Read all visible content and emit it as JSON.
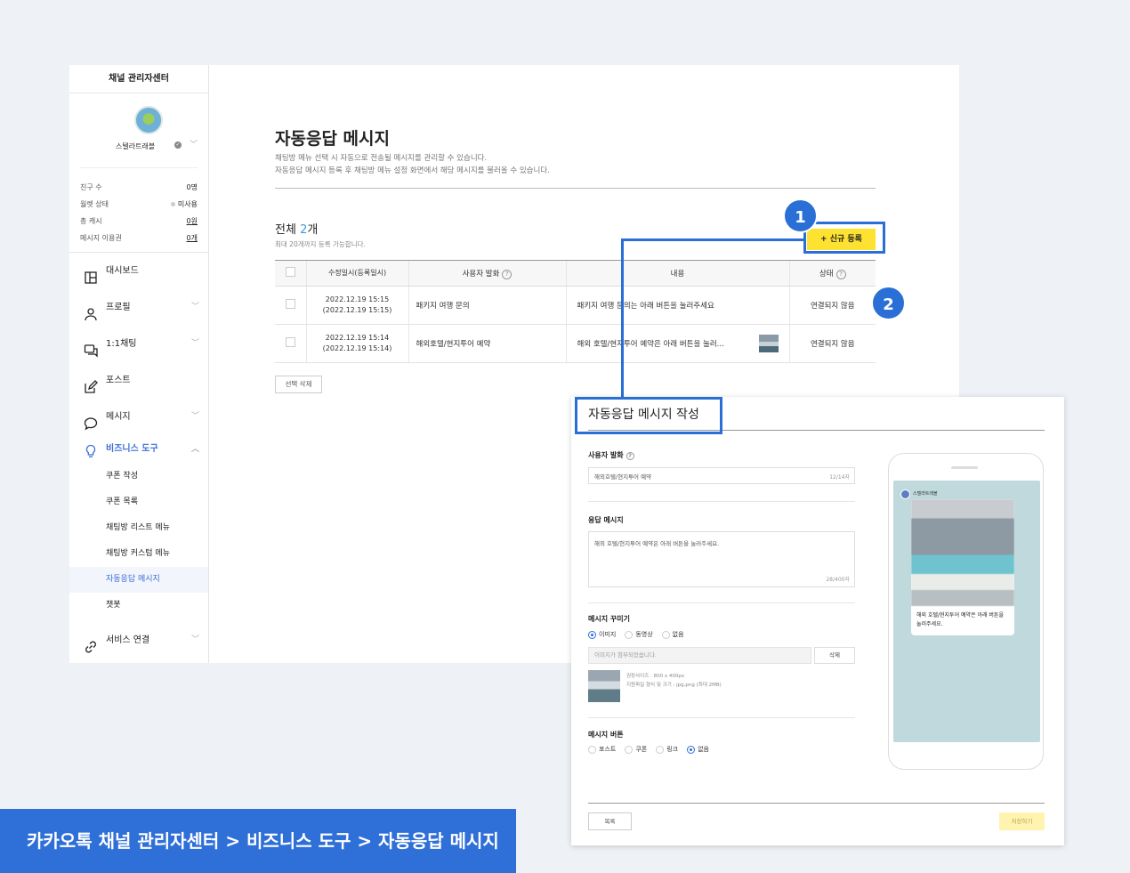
{
  "sidebar": {
    "title": "채널 관리자센터",
    "channel_name": "스텔라트래블",
    "stats": [
      {
        "label": "친구 수",
        "value": "0명"
      },
      {
        "label": "월렛 상태",
        "value": "미사용"
      },
      {
        "label": "총 캐시",
        "value": "0원"
      },
      {
        "label": "메시지 이용권",
        "value": "0개"
      }
    ],
    "nav": [
      {
        "label": "대시보드",
        "icon": "dashboard-icon"
      },
      {
        "label": "프로필",
        "icon": "person-icon"
      },
      {
        "label": "1:1채팅",
        "icon": "chat-icon"
      },
      {
        "label": "포스트",
        "icon": "edit-icon"
      },
      {
        "label": "메시지",
        "icon": "message-icon"
      },
      {
        "label": "비즈니스 도구",
        "icon": "lightbulb-icon"
      },
      {
        "label": "서비스 연결",
        "icon": "link-icon"
      }
    ],
    "business_sub": [
      "쿠폰 작성",
      "쿠폰 목록",
      "채팅방 리스트 메뉴",
      "채팅방 커스텀 메뉴",
      "자동응답 메시지",
      "챗봇"
    ]
  },
  "main": {
    "title": "자동응답 메시지",
    "desc1": "채팅방 메뉴 선택 시 자동으로 전송될 메시지를 관리할 수 있습니다.",
    "desc2": "자동응답 메시지 등록 후 채팅방 메뉴 설정 화면에서 해당 메시지를 불러올 수 있습니다.",
    "total_label": "전체 ",
    "total_count": "2",
    "total_unit": "개",
    "limit_note": "최대 20개까지 등록 가능합니다.",
    "new_button": "+ 신규 등록",
    "delete_button": "선택 삭제",
    "columns": [
      "수정일시(등록일시)",
      "사용자 발화",
      "내용",
      "상태"
    ],
    "rows": [
      {
        "date": "2022.12.19 15:15",
        "date_reg": "(2022.12.19 15:15)",
        "utterance": "패키지 여행 문의",
        "content": "패키지 여행 문의는 아래 버튼을 눌러주세요",
        "status": "연결되지 않음"
      },
      {
        "date": "2022.12.19 15:14",
        "date_reg": "(2022.12.19 15:14)",
        "utterance": "해외호텔/현지투어 예약",
        "content": "해외 호텔/현지투어 예약은 아래 버튼을 눌러...",
        "status": "연결되지 않음"
      }
    ]
  },
  "markers": [
    "1",
    "2"
  ],
  "editor": {
    "title": "자동응답 메시지 작성",
    "utterance_label": "사용자 발화",
    "utterance_value": "해외호텔/현지투어 예약",
    "utterance_count": "12/14자",
    "response_label": "응답 메시지",
    "response_value": "해외 호텔/현지투어 예약은 아래 버튼을 눌러주세요.",
    "response_count": "28/400자",
    "decorate_label": "메시지 꾸미기",
    "decorate_options": [
      "이미지",
      "동영상",
      "없음"
    ],
    "file_placeholder": "이미지가 첨부되었습니다.",
    "file_delete": "삭제",
    "img_info1": "권장사이즈 : 800 x 400px",
    "img_info2": "지원파일 형식 및 크기 : jpg,png (최대 2MB)",
    "button_label": "메시지 버튼",
    "button_options": [
      "포스트",
      "쿠폰",
      "링크",
      "없음"
    ],
    "list_button": "목록",
    "save_button": "저장하기"
  },
  "preview": {
    "channel_name": "스텔라트래블",
    "message": "해외 호텔/현지투어 예약은 아래 버튼을 눌러주세요."
  },
  "caption": "카카오톡 채널 관리자센터 > 비즈니스 도구 > 자동응답 메시지",
  "colors": {
    "accent": "#2a6fd6",
    "brand_yellow": "#fde232",
    "caption_bg": "#2f6fd8"
  }
}
